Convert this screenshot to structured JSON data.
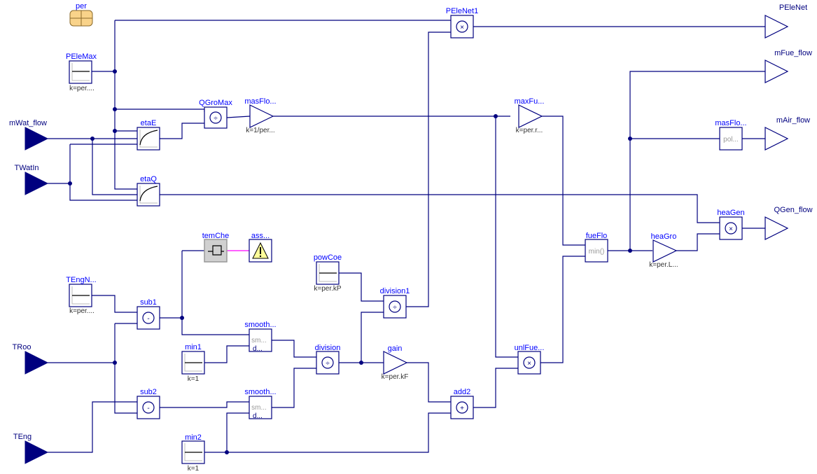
{
  "diagram": {
    "record": {
      "label": "per"
    },
    "inputs": [
      {
        "id": "mWat_flow",
        "label": "mWat_flow"
      },
      {
        "id": "TWatIn",
        "label": "TWatIn"
      },
      {
        "id": "TRoo",
        "label": "TRoo"
      },
      {
        "id": "TEng",
        "label": "TEng"
      }
    ],
    "outputs": [
      {
        "id": "PEleNet",
        "label": "PEleNet"
      },
      {
        "id": "mFue_flow",
        "label": "mFue_flow"
      },
      {
        "id": "mAir_flow",
        "label": "mAir_flow"
      },
      {
        "id": "QGen_flow",
        "label": "QGen_flow"
      }
    ],
    "blocks": {
      "PEleMax": {
        "label": "PEleMax",
        "param": "k=per...."
      },
      "QGroMax": {
        "label": "QGroMax",
        "symbol": "÷"
      },
      "masFlo1": {
        "label": "masFlo...",
        "param": "k=1/per..."
      },
      "etaE": {
        "label": "etaE"
      },
      "etaQ": {
        "label": "etaQ"
      },
      "PEleNet1": {
        "label": "PEleNet1",
        "symbol": "×"
      },
      "maxFu": {
        "label": "maxFu...",
        "param": "k=per.r..."
      },
      "masFlo2": {
        "label": "masFlo...",
        "inner": "pol..."
      },
      "heaGen": {
        "label": "heaGen",
        "symbol": "×"
      },
      "fueFlo": {
        "label": "fueFlo",
        "inner": "min()"
      },
      "heaGro": {
        "label": "heaGro",
        "param": "k=per.L..."
      },
      "temChe": {
        "label": "temChe"
      },
      "ass": {
        "label": "ass..."
      },
      "TEngN": {
        "label": "TEngN...",
        "param": "k=per...."
      },
      "sub1": {
        "label": "sub1",
        "symbol": "-"
      },
      "sub2": {
        "label": "sub2",
        "symbol": "-"
      },
      "smooth1": {
        "label": "smooth...",
        "inner": "sm...",
        "inner2": "d..."
      },
      "smooth2": {
        "label": "smooth...",
        "inner": "sm...",
        "inner2": "d..."
      },
      "min1": {
        "label": "min1",
        "param": "k=1"
      },
      "min2": {
        "label": "min2",
        "param": "k=1"
      },
      "division": {
        "label": "division",
        "symbol": "÷"
      },
      "powCoe": {
        "label": "powCoe",
        "param": "k=per.kP"
      },
      "division1": {
        "label": "division1",
        "symbol": "÷"
      },
      "gain": {
        "label": "gain",
        "param": "k=per.kF"
      },
      "add2": {
        "label": "add2",
        "symbol": "+"
      },
      "unlFue": {
        "label": "unlFue...",
        "symbol": "×"
      }
    },
    "colors": {
      "wire": "#00007f",
      "label": "#0000ff",
      "assert_wire": "#ff00ff",
      "record": "#f9d38a",
      "warning": "#ffffaa"
    }
  }
}
